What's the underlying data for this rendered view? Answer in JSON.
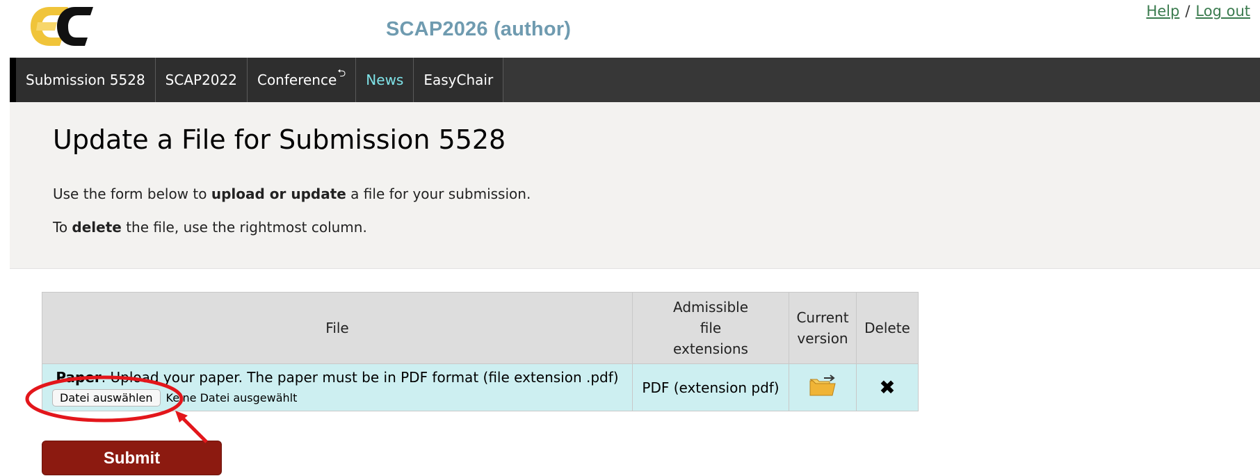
{
  "header": {
    "conference_title": "SCAP2026 (author)",
    "help_link": "Help",
    "separator": "/",
    "logout_link": "Log out",
    "logo_colors": {
      "left": "#f0c43a",
      "right": "#111111"
    }
  },
  "nav": {
    "tabs": [
      {
        "label": "Submission 5528"
      },
      {
        "label": "SCAP2022"
      },
      {
        "label": "Conference",
        "icon": "return-icon"
      },
      {
        "label": "News"
      },
      {
        "label": "EasyChair"
      }
    ]
  },
  "panel": {
    "title": "Update a File for Submission 5528",
    "line1_prefix": "Use the form below to ",
    "line1_bold": "upload or update",
    "line1_suffix": " a file for your submission.",
    "line2_prefix": "To ",
    "line2_bold": "delete",
    "line2_suffix": " the file, use the rightmost column."
  },
  "table": {
    "headers": {
      "file": "File",
      "ext_line1": "Admissible",
      "ext_line2": "file",
      "ext_line3": "extensions",
      "current_line1": "Current",
      "current_line2": "version",
      "delete": "Delete"
    },
    "row": {
      "file_name": "Paper",
      "file_desc": ". Upload your paper. The paper must be in PDF format (file extension .pdf)",
      "choose_button": "Datei auswählen",
      "no_file_text": "Keine Datei ausgewählt",
      "extensions": "PDF (extension pdf)",
      "current_icon": "folder-icon",
      "delete_icon": "close-icon"
    }
  },
  "submit_label": "Submit",
  "annotation_color": "#e3161b"
}
